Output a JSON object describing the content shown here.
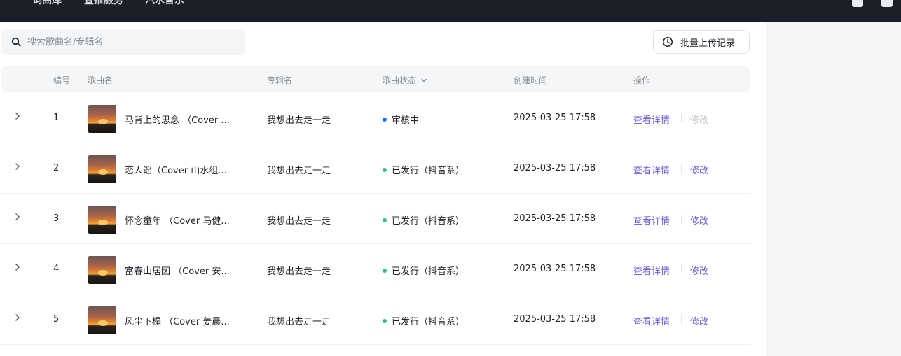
{
  "topnav": {
    "items": [
      "词曲库",
      "宣推服务",
      "汽水音乐"
    ]
  },
  "search": {
    "placeholder": "搜索歌曲名/专辑名",
    "value": ""
  },
  "toolbar": {
    "upload_history_label": "批量上传记录"
  },
  "table": {
    "columns": {
      "number": "编号",
      "song": "歌曲名",
      "album": "专辑名",
      "status": "歌曲状态",
      "created": "创建时间",
      "actions": "操作"
    },
    "rows": [
      {
        "number": "1",
        "song": "马背上的思念 （Cover ...",
        "album": "我想出去走一走",
        "status": "审核中",
        "status_color": "#1e6fff",
        "created": "2025-03-25 17:58",
        "detail": "查看详情",
        "modify": "修改",
        "modify_enabled": false
      },
      {
        "number": "2",
        "song": "恋人谣（Cover 山水组...",
        "album": "我想出去走一走",
        "status": "已发行（抖音系）",
        "status_color": "#27c47e",
        "created": "2025-03-25 17:58",
        "detail": "查看详情",
        "modify": "修改",
        "modify_enabled": true
      },
      {
        "number": "3",
        "song": "怀念童年 （Cover 马健...",
        "album": "我想出去走一走",
        "status": "已发行（抖音系）",
        "status_color": "#27c47e",
        "created": "2025-03-25 17:58",
        "detail": "查看详情",
        "modify": "修改",
        "modify_enabled": true
      },
      {
        "number": "4",
        "song": "富春山居图 （Cover 安...",
        "album": "我想出去走一走",
        "status": "已发行（抖音系）",
        "status_color": "#27c47e",
        "created": "2025-03-25 17:58",
        "detail": "查看详情",
        "modify": "修改",
        "modify_enabled": true
      },
      {
        "number": "5",
        "song": "风尘下榻 （Cover 姜晨...",
        "album": "我想出去走一走",
        "status": "已发行（抖音系）",
        "status_color": "#27c47e",
        "created": "2025-03-25 17:58",
        "detail": "查看详情",
        "modify": "修改",
        "modify_enabled": true
      }
    ]
  },
  "colors": {
    "accent": "#6e59d9",
    "topbar": "#1b1f27",
    "disabled": "#c2c5cc"
  }
}
